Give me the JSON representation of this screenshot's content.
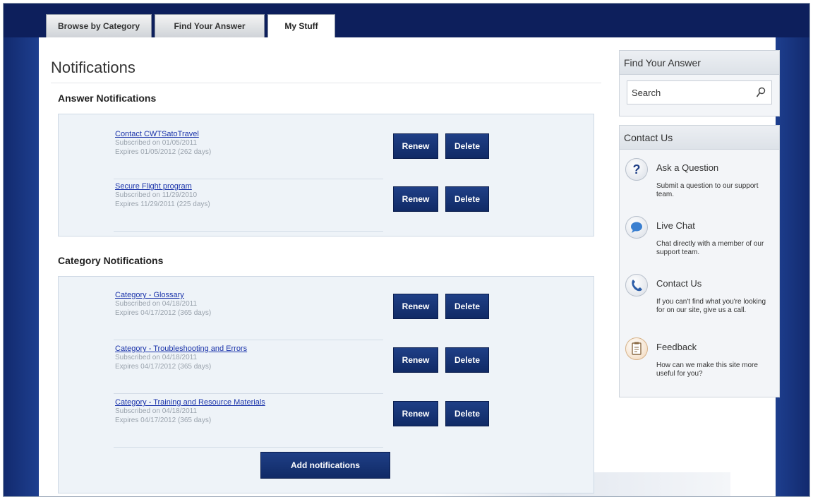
{
  "tabs": [
    {
      "label": "Browse by Category"
    },
    {
      "label": "Find Your Answer"
    },
    {
      "label": "My Stuff"
    }
  ],
  "page_title": "Notifications",
  "answer_section": {
    "heading": "Answer Notifications",
    "items": [
      {
        "title": "Contact CWTSatoTravel",
        "subscribed": "Subscribed on 01/05/2011",
        "expires": "Expires 01/05/2012 (262 days)"
      },
      {
        "title": "Secure Flight program",
        "subscribed": "Subscribed on 11/29/2010",
        "expires": "Expires 11/29/2011 (225 days)"
      }
    ]
  },
  "category_section": {
    "heading": "Category Notifications",
    "items": [
      {
        "title": "Category - Glossary",
        "subscribed": "Subscribed on 04/18/2011",
        "expires": "Expires 04/17/2012 (365 days)"
      },
      {
        "title": "Category - Troubleshooting and Errors",
        "subscribed": "Subscribed on 04/18/2011",
        "expires": "Expires 04/17/2012 (365 days)"
      },
      {
        "title": "Category - Training and Resource Materials",
        "subscribed": "Subscribed on 04/18/2011",
        "expires": "Expires 04/17/2012 (365 days)"
      }
    ]
  },
  "buttons": {
    "renew": "Renew",
    "delete": "Delete",
    "add": "Add notifications"
  },
  "sidebar": {
    "find_title": "Find Your Answer",
    "search_placeholder": "Search",
    "contact_title": "Contact Us",
    "items": [
      {
        "icon": "question-icon",
        "title": "Ask a Question",
        "desc": "Submit a question to our support team."
      },
      {
        "icon": "chat-bubble-icon",
        "title": "Live Chat",
        "desc": "Chat directly with a member of our support team."
      },
      {
        "icon": "phone-icon",
        "title": "Contact Us",
        "desc": "If you can't find what you're looking for on our site, give us a call."
      },
      {
        "icon": "clipboard-icon",
        "title": "Feedback",
        "desc": "How can we make this site more useful for you?"
      }
    ]
  },
  "colors": {
    "nav_bg": "#0d1f5c",
    "button_bg": "#102a66",
    "link": "#1a33aa",
    "panel_bg": "#eef3f8"
  }
}
